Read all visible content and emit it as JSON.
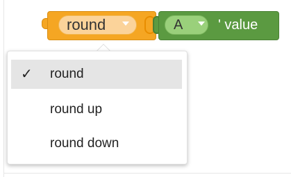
{
  "round_block": {
    "dropdown_value": "round"
  },
  "text_block": {
    "field_value": "A",
    "suffix": "' value"
  },
  "menu": {
    "items": [
      {
        "label": "round",
        "selected": true,
        "check": "✓"
      },
      {
        "label": "round up",
        "selected": false,
        "check": ""
      },
      {
        "label": "round down",
        "selected": false,
        "check": ""
      }
    ]
  },
  "colors": {
    "round_block": "#f5a623",
    "text_block": "#5b9a41"
  }
}
